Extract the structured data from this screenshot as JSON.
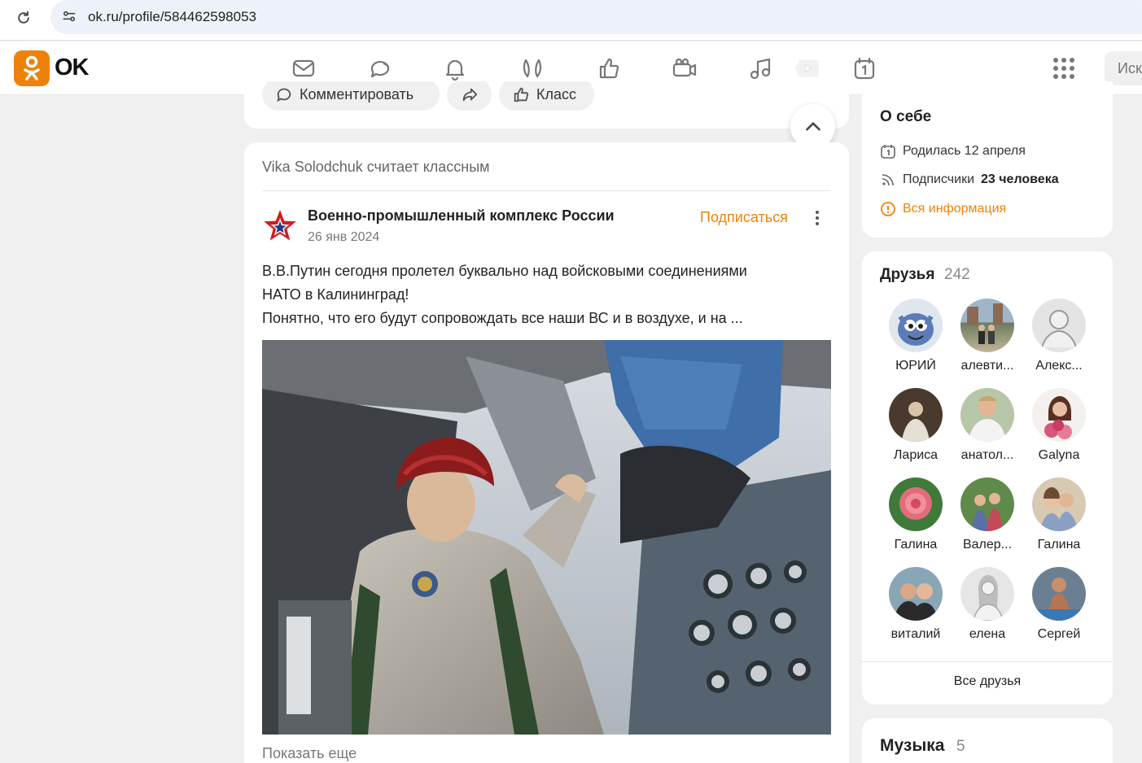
{
  "browser": {
    "url": "ok.ru/profile/584462598053"
  },
  "header": {
    "logo_text": "OK",
    "search_placeholder": "Иск",
    "nav": [
      "mail-icon",
      "chat-icon",
      "bell-icon",
      "guests-icon",
      "like-icon",
      "video-chat-icon",
      "music-icon",
      "video-icon",
      "calendar-icon"
    ]
  },
  "prev_post": {
    "comment_label": "Комментировать",
    "klass_label": "Класс"
  },
  "post": {
    "context": "Vika Solodchuk считает классным",
    "group_name": "Военно-промышленный комплекс России",
    "date": "26 янв 2024",
    "subscribe_label": "Подписаться",
    "text_line1": "В.В.Путин сегодня пролетел буквально над войсковыми соединениями",
    "text_line2": "НАТО в Калининград!",
    "text_line3": "Понятно, что его будут сопровождать все наши ВС и в воздухе, и на ...",
    "show_more": "Показать еще"
  },
  "about": {
    "title": "О себе",
    "birthday": "Родилась 12 апреля",
    "subscribers_prefix": "Подписчики",
    "subscribers_value": "23 человека",
    "all_info": "Вся информация"
  },
  "friends": {
    "title": "Друзья",
    "count": "242",
    "items": [
      {
        "name": "ЮРИЙ"
      },
      {
        "name": "алевти..."
      },
      {
        "name": "Алекс..."
      },
      {
        "name": "Лариса"
      },
      {
        "name": "анатол..."
      },
      {
        "name": "Galyna"
      },
      {
        "name": "Галина"
      },
      {
        "name": "Валер..."
      },
      {
        "name": "Галина"
      },
      {
        "name": "виталий"
      },
      {
        "name": "елена"
      },
      {
        "name": "Сергей"
      }
    ],
    "all_label": "Все друзья"
  },
  "music": {
    "title": "Музыка",
    "count": "5"
  },
  "colors": {
    "accent": "#ee8208",
    "background": "#f0f0f0"
  }
}
